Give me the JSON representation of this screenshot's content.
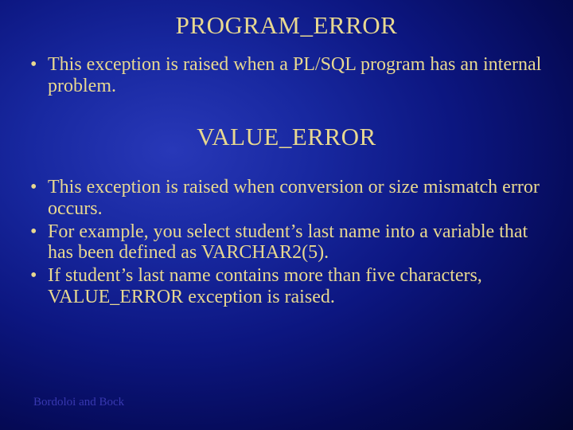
{
  "slide": {
    "heading1": "PROGRAM_ERROR",
    "bullets1": [
      "This exception is raised when a PL/SQL program has an internal problem."
    ],
    "heading2": "VALUE_ERROR",
    "bullets2": [
      "This exception is raised when conversion or size mismatch error occurs.",
      "For example, you select student’s last name into a variable that has been defined as VARCHAR2(5).",
      "If student’s last name contains more than five characters, VALUE_ERROR exception is raised."
    ],
    "footer": "Bordoloi and Bock"
  }
}
